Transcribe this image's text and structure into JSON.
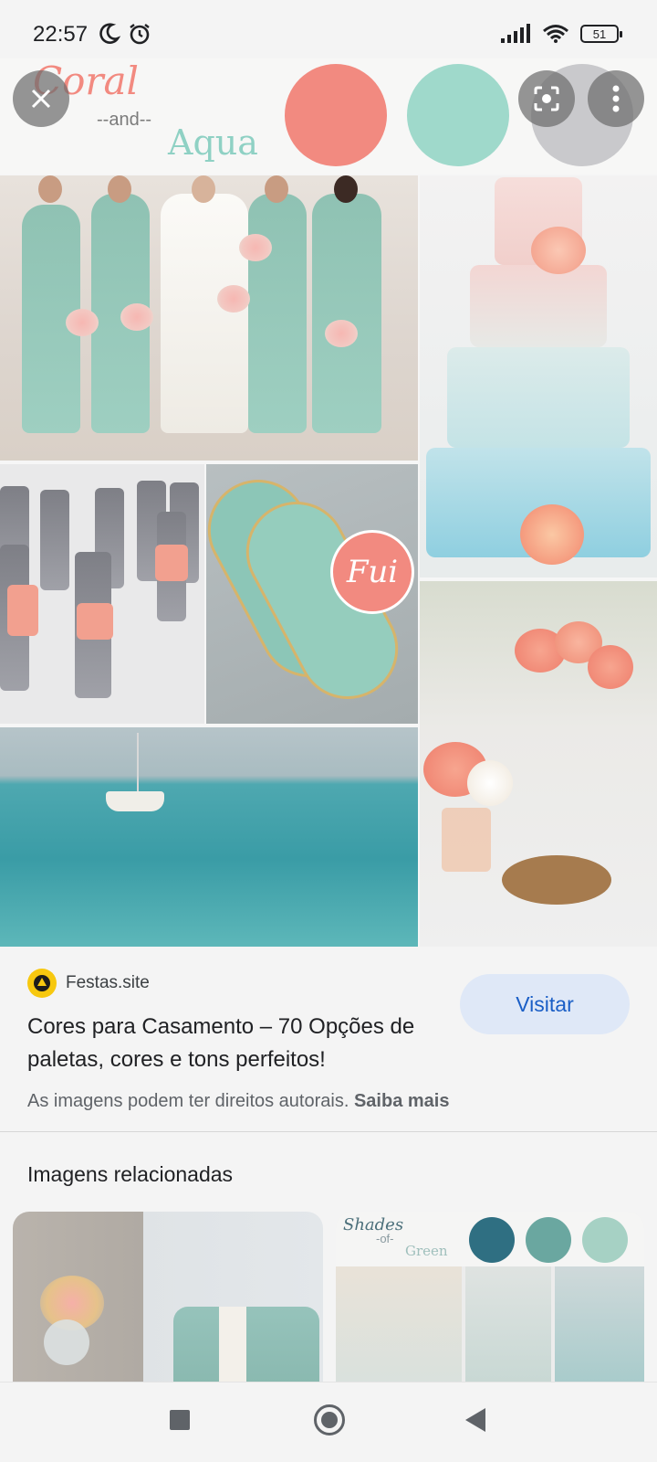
{
  "status_bar": {
    "time": "22:57",
    "battery": "51",
    "icons": [
      "moon-icon",
      "alarm-icon",
      "signal-icon",
      "wifi-icon",
      "battery-icon"
    ]
  },
  "image": {
    "logo_word_1": "Coral",
    "logo_connector": "--and--",
    "logo_word_2": "Aqua",
    "badge_text": "Fui",
    "palette_colors": [
      "#f28a80",
      "#9fd9cb",
      "#c9c9cc"
    ]
  },
  "overlay": {
    "close_icon": "close-icon",
    "lens_icon": "lens-icon",
    "more_icon": "more-vert-icon"
  },
  "result": {
    "source_name": "Festas.site",
    "title": "Cores para Casamento – 70 Opções de paletas, cores e tons perfeitos!",
    "visit_label": "Visitar",
    "copyright_text": "As imagens podem ter direitos autorais.",
    "learn_more": "Saiba mais"
  },
  "related": {
    "heading": "Imagens relacionadas",
    "card2_title": "Shades",
    "card2_of": "-of-",
    "card2_word": "Green",
    "card2_colors": [
      "#2f6f82",
      "#6aa7a0",
      "#a6d1c4"
    ]
  },
  "colors": {
    "accent_blue": "#1a5ec6",
    "visit_bg": "#dfe8f7",
    "coral": "#f28a80",
    "aqua": "#9fd9cb"
  }
}
